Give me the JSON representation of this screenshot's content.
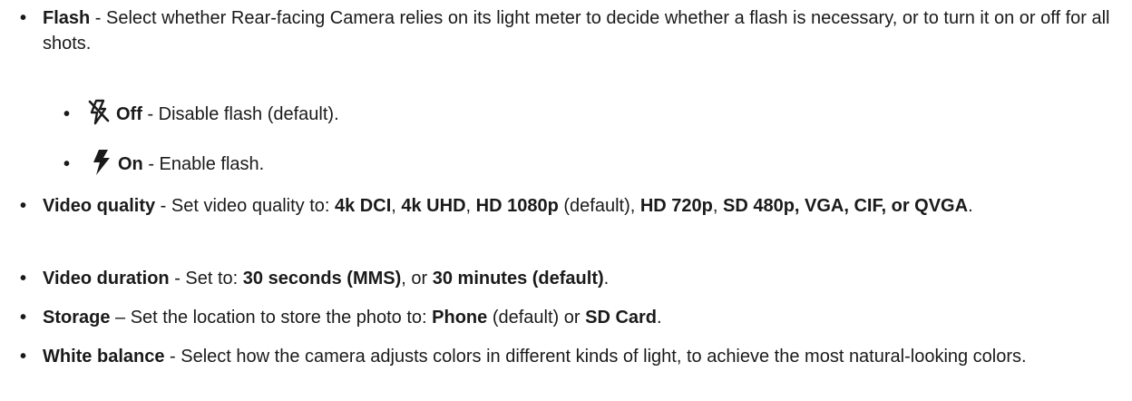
{
  "bullet_char": "•",
  "flash": {
    "term": "Flash",
    "desc": " - Select whether Rear-facing Camera relies on its light meter to decide whether a flash is necessary, or to turn it on or off for all shots.",
    "off": {
      "icon": "flash-off-icon",
      "label": "Off",
      "desc": " - Disable flash (default)."
    },
    "on": {
      "icon": "flash-on-icon",
      "label": "On",
      "desc": " - Enable flash."
    }
  },
  "video_quality": {
    "term": "Video quality",
    "desc": " - Set video quality to: ",
    "opt1": "4k DCI",
    "sep1": ", ",
    "opt2": "4k UHD",
    "sep2": ", ",
    "opt3": "HD 1080p",
    "sep3": " (default), ",
    "opt4": "HD 720p",
    "sep4": ", ",
    "opt5": "SD 480p, VGA, CIF, or QVGA",
    "end": "."
  },
  "video_duration": {
    "term": "Video duration",
    "desc": " - Set to: ",
    "opt1": "30 seconds (MMS)",
    "sep1": ", or ",
    "opt2": "30 minutes (default)",
    "end": "."
  },
  "storage": {
    "term": "Storage",
    "desc": " – Set the location to store the photo to: ",
    "opt1": "Phone",
    "sep1": " (default) or ",
    "opt2": "SD Card",
    "end": "."
  },
  "white_balance": {
    "term": "White balance",
    "desc": " - Select how the camera adjusts colors in different kinds of light, to achieve the most natural-looking colors."
  }
}
